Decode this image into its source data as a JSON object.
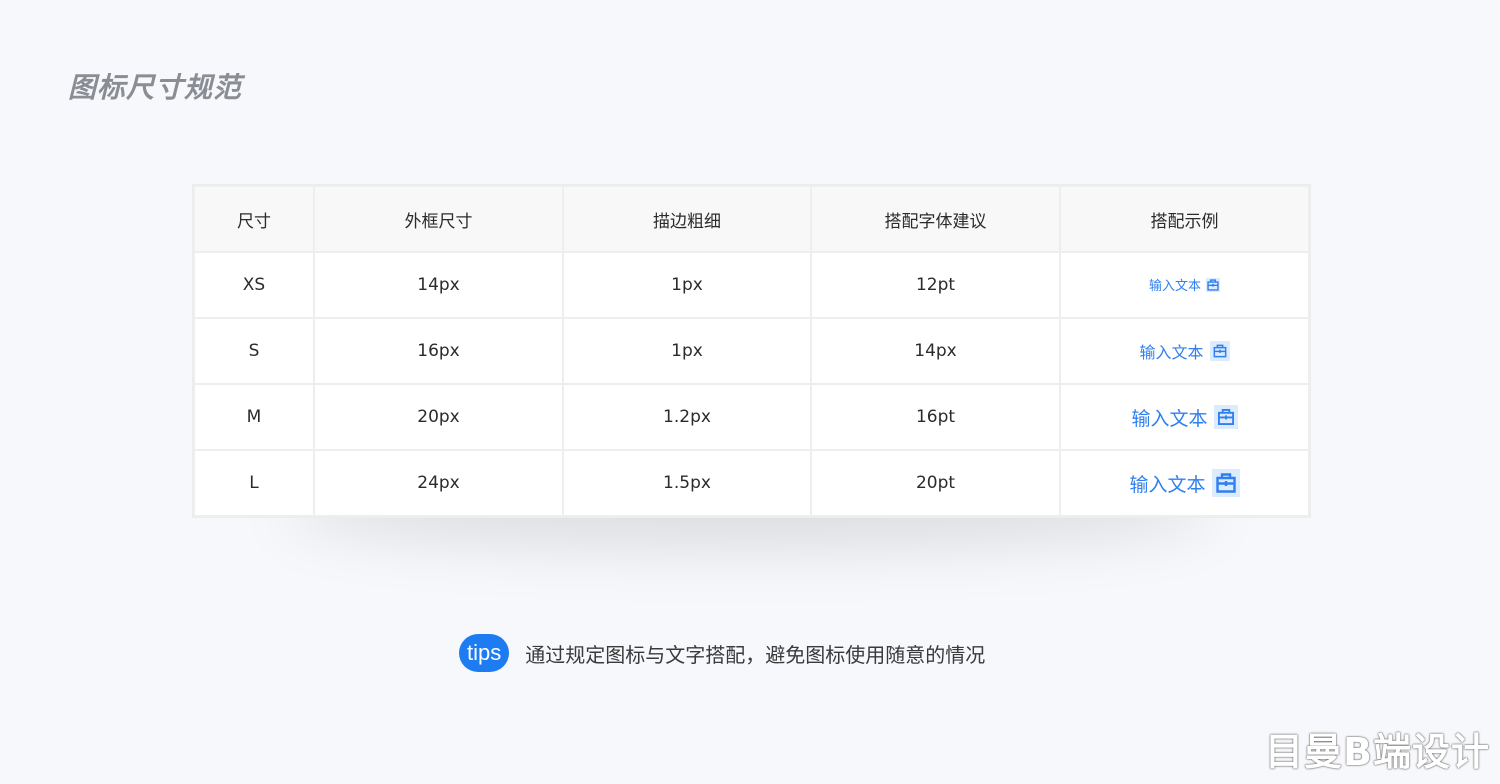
{
  "page": {
    "title": "图标尺寸规范",
    "background": "#f7f8fb"
  },
  "table": {
    "headers": [
      "尺寸",
      "外框尺寸",
      "描边粗细",
      "搭配字体建议",
      "搭配示例"
    ],
    "rows": [
      {
        "size": "XS",
        "frame": "14px",
        "stroke": "1px",
        "font": "12pt",
        "example_text": "输入文本",
        "example_icon": "store-icon"
      },
      {
        "size": "S",
        "frame": "16px",
        "stroke": "1px",
        "font": "14px",
        "example_text": "输入文本",
        "example_icon": "store-icon"
      },
      {
        "size": "M",
        "frame": "20px",
        "stroke": "1.2px",
        "font": "16pt",
        "example_text": "输入文本",
        "example_icon": "store-icon"
      },
      {
        "size": "L",
        "frame": "24px",
        "stroke": "1.5px",
        "font": "20pt",
        "example_text": "输入文本",
        "example_icon": "store-icon"
      }
    ]
  },
  "tips": {
    "badge": "tips",
    "text": "通过规定图标与文字搭配，避免图标使用随意的情况"
  },
  "watermark": "目曼B端设计",
  "colors": {
    "accent": "#1e7cf2",
    "example_text": "#2f7ff0",
    "icon_bg": "#dcebfd"
  }
}
